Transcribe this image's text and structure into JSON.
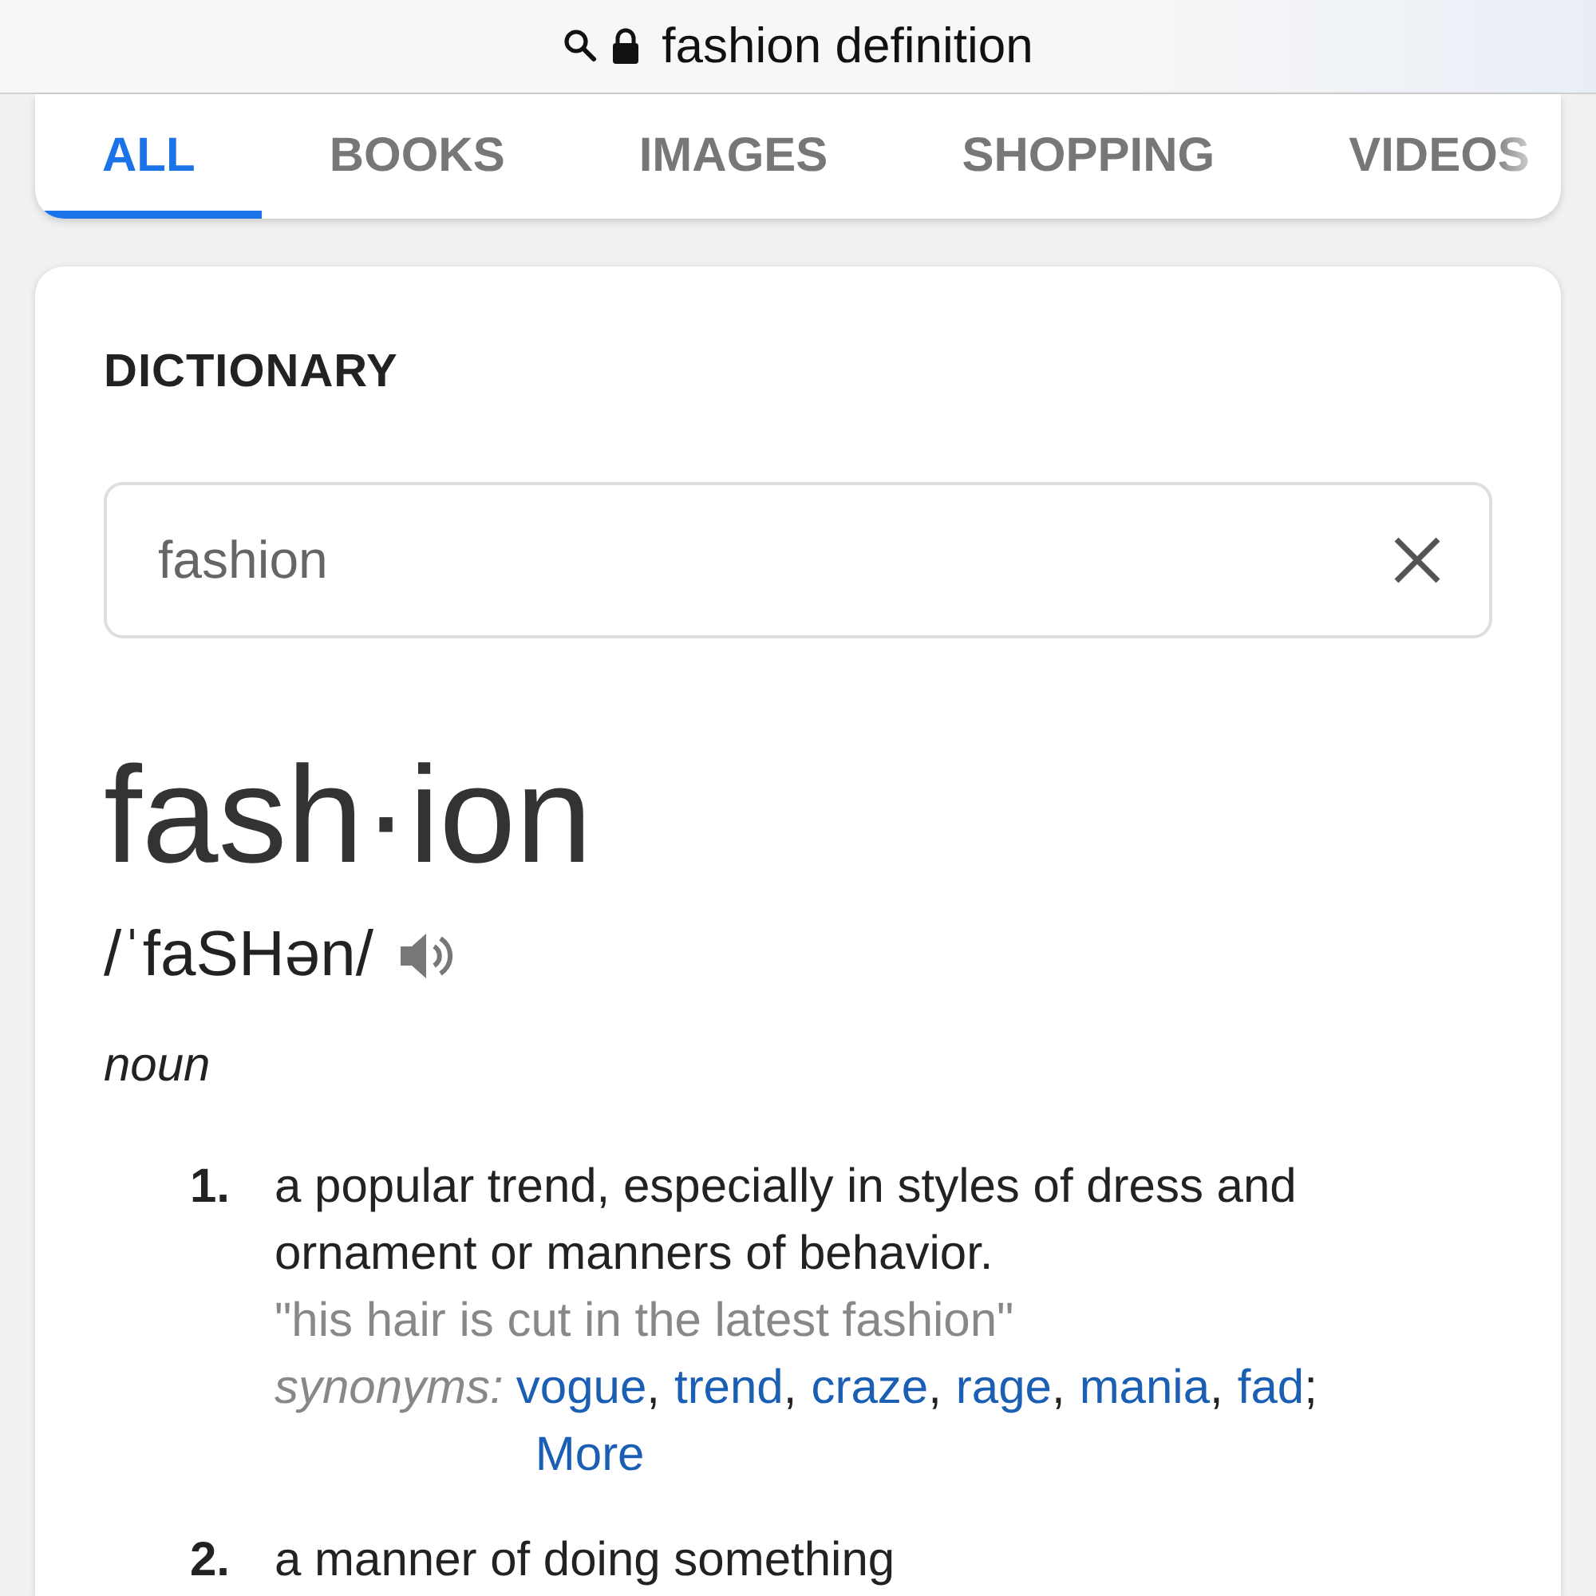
{
  "address_bar": {
    "text": "fashion definition"
  },
  "tabs": [
    {
      "label": "ALL",
      "selected": true
    },
    {
      "label": "BOOKS",
      "selected": false
    },
    {
      "label": "IMAGES",
      "selected": false
    },
    {
      "label": "SHOPPING",
      "selected": false
    },
    {
      "label": "VIDEOS",
      "selected": false
    }
  ],
  "dictionary": {
    "heading": "DICTIONARY",
    "search": {
      "value": "fashion"
    },
    "headword": "fash·ion",
    "pronunciation": "/ˈfaSHən/",
    "part_of_speech": "noun",
    "senses": [
      {
        "number": "1.",
        "definition": "a popular trend, especially in styles of dress and ornament or manners of behavior.",
        "example": "\"his hair is cut in the latest fashion\"",
        "synonyms_label": "synonyms:",
        "synonyms": [
          {
            "word": "vogue",
            "after": ","
          },
          {
            "word": "trend",
            "after": ","
          },
          {
            "word": "craze",
            "after": ","
          },
          {
            "word": "rage",
            "after": ","
          },
          {
            "word": "mania",
            "after": ","
          },
          {
            "word": "fad",
            "after": ";"
          }
        ],
        "more": "More"
      },
      {
        "number": "2.",
        "definition": "a manner of doing something"
      }
    ]
  }
}
